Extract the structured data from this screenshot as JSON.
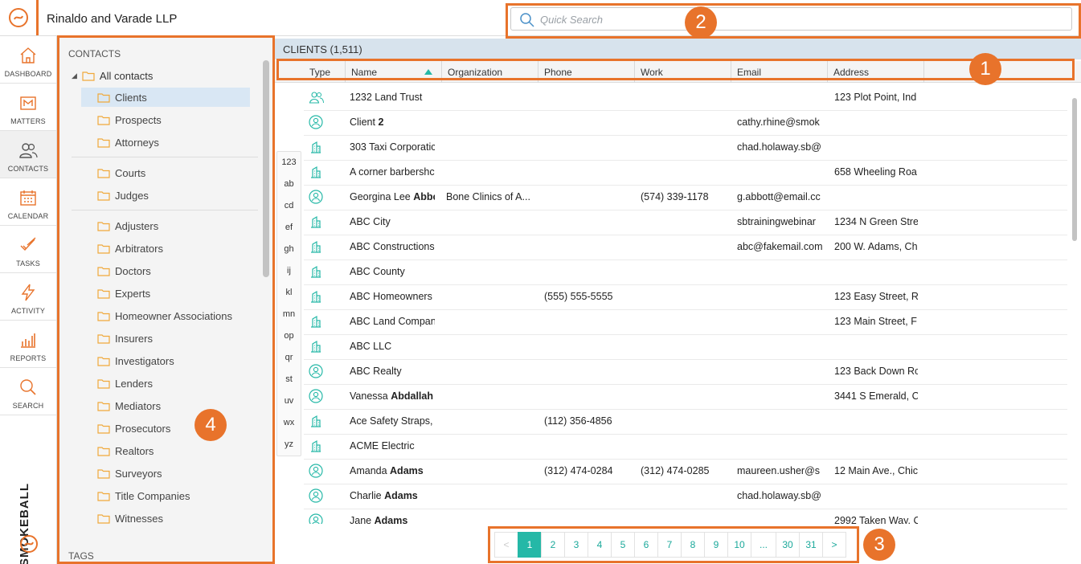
{
  "topbar": {
    "firm_name": "Rinaldo and Varade LLP",
    "search_placeholder": "Quick Search"
  },
  "nav": [
    {
      "label": "DASHBOARD",
      "icon": "home-icon"
    },
    {
      "label": "MATTERS",
      "icon": "matters-icon"
    },
    {
      "label": "CONTACTS",
      "icon": "contacts-icon",
      "active": true
    },
    {
      "label": "CALENDAR",
      "icon": "calendar-icon"
    },
    {
      "label": "TASKS",
      "icon": "tasks-icon"
    },
    {
      "label": "ACTIVITY",
      "icon": "activity-icon"
    },
    {
      "label": "REPORTS",
      "icon": "reports-icon"
    },
    {
      "label": "SEARCH",
      "icon": "search-icon"
    }
  ],
  "brand": "SMOKEBALL",
  "tree": {
    "heading": "CONTACTS",
    "all_contacts": "All contacts",
    "folders": [
      "Clients",
      "Prospects",
      "Attorneys",
      "Courts",
      "Judges",
      "Adjusters",
      "Arbitrators",
      "Doctors",
      "Experts",
      "Homeowner Associations",
      "Insurers",
      "Investigators",
      "Lenders",
      "Mediators",
      "Prosecutors",
      "Realtors",
      "Surveyors",
      "Title Companies",
      "Witnesses"
    ],
    "tags_heading": "TAGS"
  },
  "list": {
    "header": "CLIENTS (1,511)",
    "columns": [
      "Type",
      "Name",
      "Organization",
      "Phone",
      "Work",
      "Email",
      "Address"
    ],
    "alpha": [
      "123",
      "ab",
      "cd",
      "ef",
      "gh",
      "ij",
      "kl",
      "mn",
      "op",
      "qr",
      "st",
      "uv",
      "wx",
      "yz"
    ],
    "rows": [
      {
        "type": "group",
        "name": "1232 Land Trust",
        "bold": "",
        "org": "",
        "phone": "",
        "work": "",
        "email": "",
        "address": "123 Plot Point, Ind"
      },
      {
        "type": "person",
        "name": "Client ",
        "bold": "2",
        "org": "",
        "phone": "",
        "work": "",
        "email": "cathy.rhine@smok",
        "address": ""
      },
      {
        "type": "org",
        "name": "303 Taxi Corporatic",
        "bold": "",
        "org": "",
        "phone": "",
        "work": "",
        "email": "chad.holaway.sb@",
        "address": ""
      },
      {
        "type": "org",
        "name": "A corner barbershc",
        "bold": "",
        "org": "",
        "phone": "",
        "work": "",
        "email": "",
        "address": "658 Wheeling Roa"
      },
      {
        "type": "person",
        "name": "Georgina Lee ",
        "bold": "Abbo",
        "org": "Bone Clinics of A...",
        "phone": "",
        "work": "(574) 339-1178",
        "email": "g.abbott@email.cc",
        "address": ""
      },
      {
        "type": "org",
        "name": "ABC City",
        "bold": "",
        "org": "",
        "phone": "",
        "work": "",
        "email": "sbtrainingwebinar",
        "address": "1234 N Green Stre"
      },
      {
        "type": "org",
        "name": "ABC Constructions",
        "bold": "",
        "org": "",
        "phone": "",
        "work": "",
        "email": "abc@fakemail.com",
        "address": "200 W. Adams, Ch"
      },
      {
        "type": "org",
        "name": "ABC County",
        "bold": "",
        "org": "",
        "phone": "",
        "work": "",
        "email": "",
        "address": ""
      },
      {
        "type": "org",
        "name": "ABC Homeowners .",
        "bold": "",
        "org": "",
        "phone": "(555) 555-5555",
        "work": "",
        "email": "",
        "address": "123 Easy Street, Ri"
      },
      {
        "type": "org",
        "name": "ABC Land Compan",
        "bold": "",
        "org": "",
        "phone": "",
        "work": "",
        "email": "",
        "address": "123 Main Street, F"
      },
      {
        "type": "org",
        "name": "ABC LLC",
        "bold": "",
        "org": "",
        "phone": "",
        "work": "",
        "email": "",
        "address": ""
      },
      {
        "type": "person",
        "name": "ABC Realty",
        "bold": "",
        "org": "",
        "phone": "",
        "work": "",
        "email": "",
        "address": "123 Back Down Rc"
      },
      {
        "type": "person",
        "name": "Vanessa ",
        "bold": "Abdallah .",
        "org": "",
        "phone": "",
        "work": "",
        "email": "",
        "address": "3441 S Emerald, C"
      },
      {
        "type": "org",
        "name": "Ace Safety Straps, I",
        "bold": "",
        "org": "",
        "phone": "(112) 356-4856",
        "work": "",
        "email": "",
        "address": ""
      },
      {
        "type": "org",
        "name": "ACME Electric",
        "bold": "",
        "org": "",
        "phone": "",
        "work": "",
        "email": "",
        "address": ""
      },
      {
        "type": "person",
        "name": "Amanda ",
        "bold": "Adams",
        "org": "",
        "phone": "(312) 474-0284",
        "work": "(312) 474-0285",
        "email": "maureen.usher@s",
        "address": "12 Main Ave., Chic"
      },
      {
        "type": "person",
        "name": "Charlie ",
        "bold": "Adams",
        "org": "",
        "phone": "",
        "work": "",
        "email": "chad.holaway.sb@",
        "address": ""
      },
      {
        "type": "person",
        "name": "Jane ",
        "bold": "Adams",
        "org": "",
        "phone": "",
        "work": "",
        "email": "",
        "address": "2992 Taken Way, C"
      }
    ]
  },
  "pager": {
    "pages": [
      "<",
      "1",
      "2",
      "3",
      "4",
      "5",
      "6",
      "7",
      "8",
      "9",
      "10",
      "...",
      "30",
      "31",
      ">"
    ],
    "current": "1"
  },
  "callouts": [
    "1",
    "2",
    "3",
    "4"
  ],
  "colors": {
    "accent": "#e8732b",
    "teal": "#25b8a7",
    "header_bg": "#d7e3ed",
    "selected": "#d9e7f4"
  }
}
